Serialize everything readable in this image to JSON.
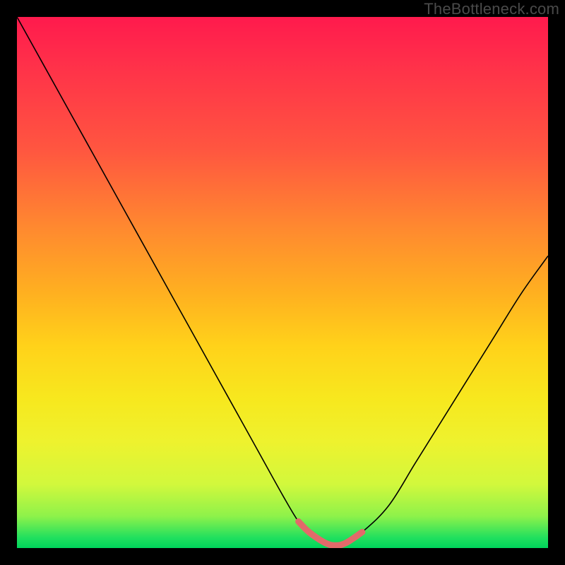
{
  "watermark": "TheBottleneck.com",
  "colors": {
    "frame": "#000000",
    "curve": "#000000",
    "highlight": "#e26a6a",
    "gradient_top": "#ff1a4d",
    "gradient_bottom": "#00d45b"
  },
  "chart_data": {
    "type": "line",
    "title": "",
    "xlabel": "",
    "ylabel": "",
    "xlim": [
      0,
      100
    ],
    "ylim": [
      0,
      100
    ],
    "grid": false,
    "legend": false,
    "series": [
      {
        "name": "bottleneck-curve",
        "x": [
          0,
          5,
          10,
          15,
          20,
          25,
          30,
          35,
          40,
          45,
          50,
          53,
          55,
          58,
          60,
          62,
          65,
          70,
          75,
          80,
          85,
          90,
          95,
          100
        ],
        "y": [
          100,
          91,
          82,
          73,
          64,
          55,
          46,
          37,
          28,
          19,
          10,
          5,
          3,
          1,
          0.5,
          1,
          3,
          8,
          16,
          24,
          32,
          40,
          48,
          55
        ]
      },
      {
        "name": "optimal-range-highlight",
        "x": [
          53,
          55,
          58,
          60,
          62,
          65
        ],
        "y": [
          5,
          3,
          1,
          0.5,
          1,
          3
        ]
      }
    ],
    "annotations": [
      {
        "text": "TheBottleneck.com",
        "position": "top-right"
      }
    ]
  }
}
